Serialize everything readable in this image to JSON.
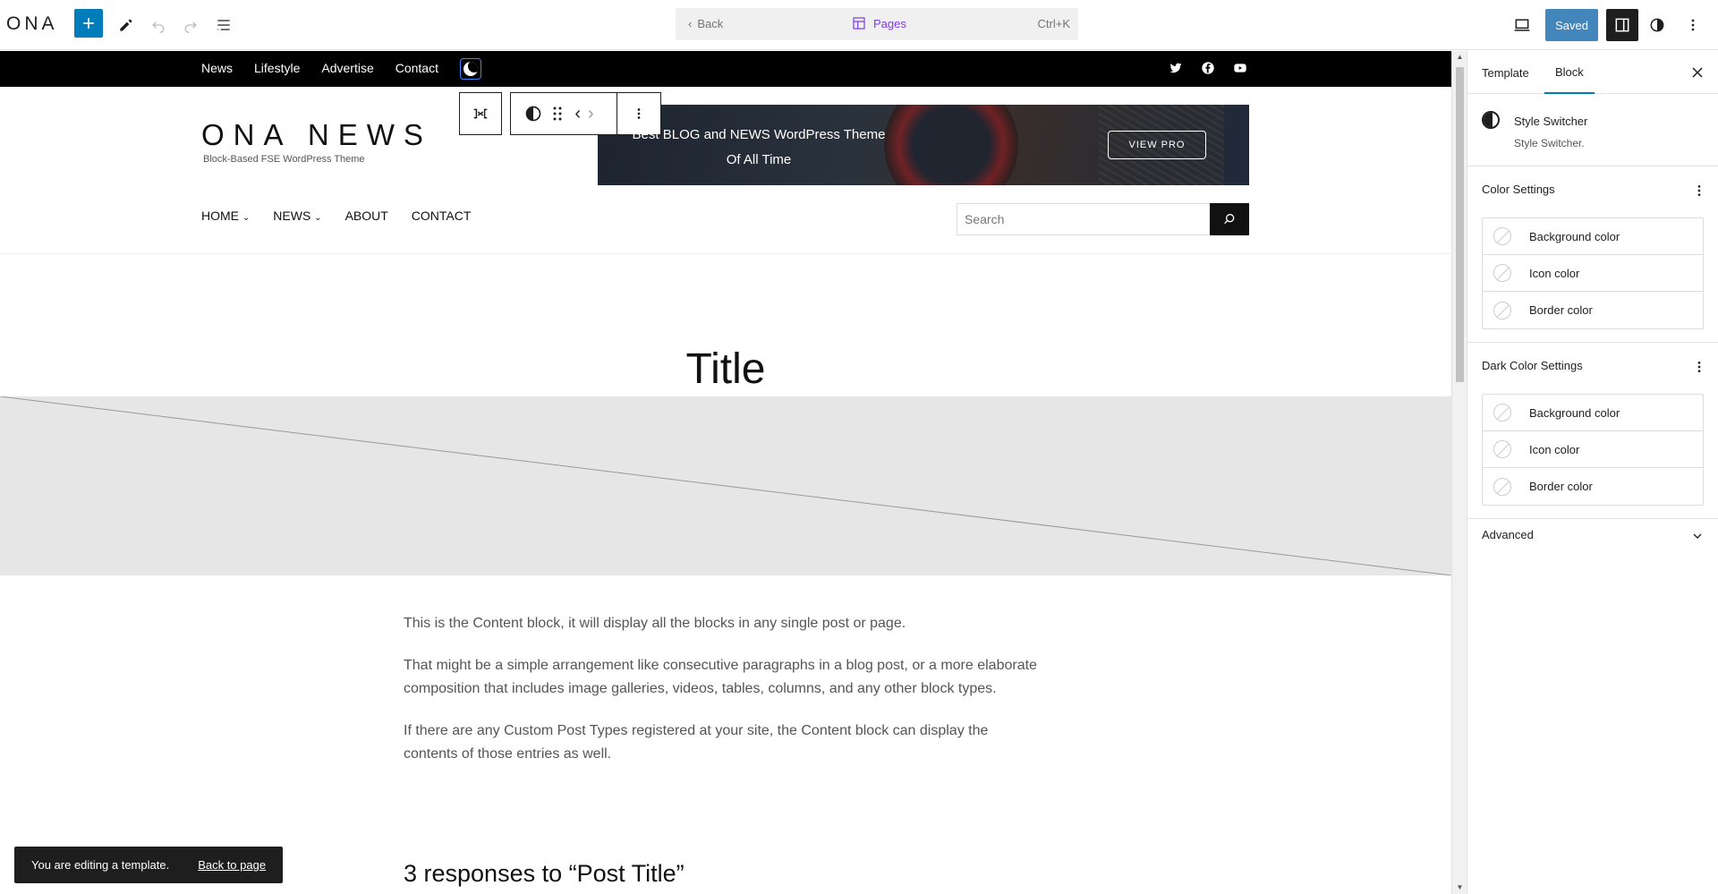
{
  "topbar": {
    "brand": "ONA",
    "command": {
      "back": "Back",
      "center": "Pages",
      "shortcut": "Ctrl+K"
    },
    "saved_label": "Saved"
  },
  "site": {
    "top_menu": [
      "News",
      "Lifestyle",
      "Advertise",
      "Contact"
    ],
    "logo": "ONA NEWS",
    "tagline": "Block-Based FSE WordPress Theme",
    "banner": {
      "line1": "Best BLOG and NEWS WordPress Theme",
      "line2": "Of All Time",
      "button": "VIEW PRO"
    },
    "main_nav": [
      "HOME",
      "NEWS",
      "ABOUT",
      "CONTACT"
    ],
    "search_placeholder": "Search",
    "title": "Title",
    "paragraphs": [
      "This is the Content block, it will display all the blocks in any single post or page.",
      "That might be a simple arrangement like consecutive paragraphs in a blog post, or a more elaborate composition that includes image galleries, videos, tables, columns, and any other block types.",
      "If there are any Custom Post Types registered at your site, the Content block can display the contents of those entries as well."
    ],
    "responses_heading": "3 responses to “Post Title”"
  },
  "snackbar": {
    "message": "You are editing a template.",
    "link": "Back to page"
  },
  "sidebar": {
    "tabs": [
      "Template",
      "Block"
    ],
    "active_tab": "Block",
    "block_name": "Style Switcher",
    "block_desc": "Style Switcher.",
    "color_settings": {
      "title": "Color Settings",
      "items": [
        "Background color",
        "Icon color",
        "Border color"
      ]
    },
    "dark_color_settings": {
      "title": "Dark Color Settings",
      "items": [
        "Background color",
        "Icon color",
        "Border color"
      ]
    },
    "advanced": "Advanced"
  },
  "colors": {
    "accent": "#007cba",
    "saved": "#2271b1",
    "pages_link": "#7c3aed"
  }
}
